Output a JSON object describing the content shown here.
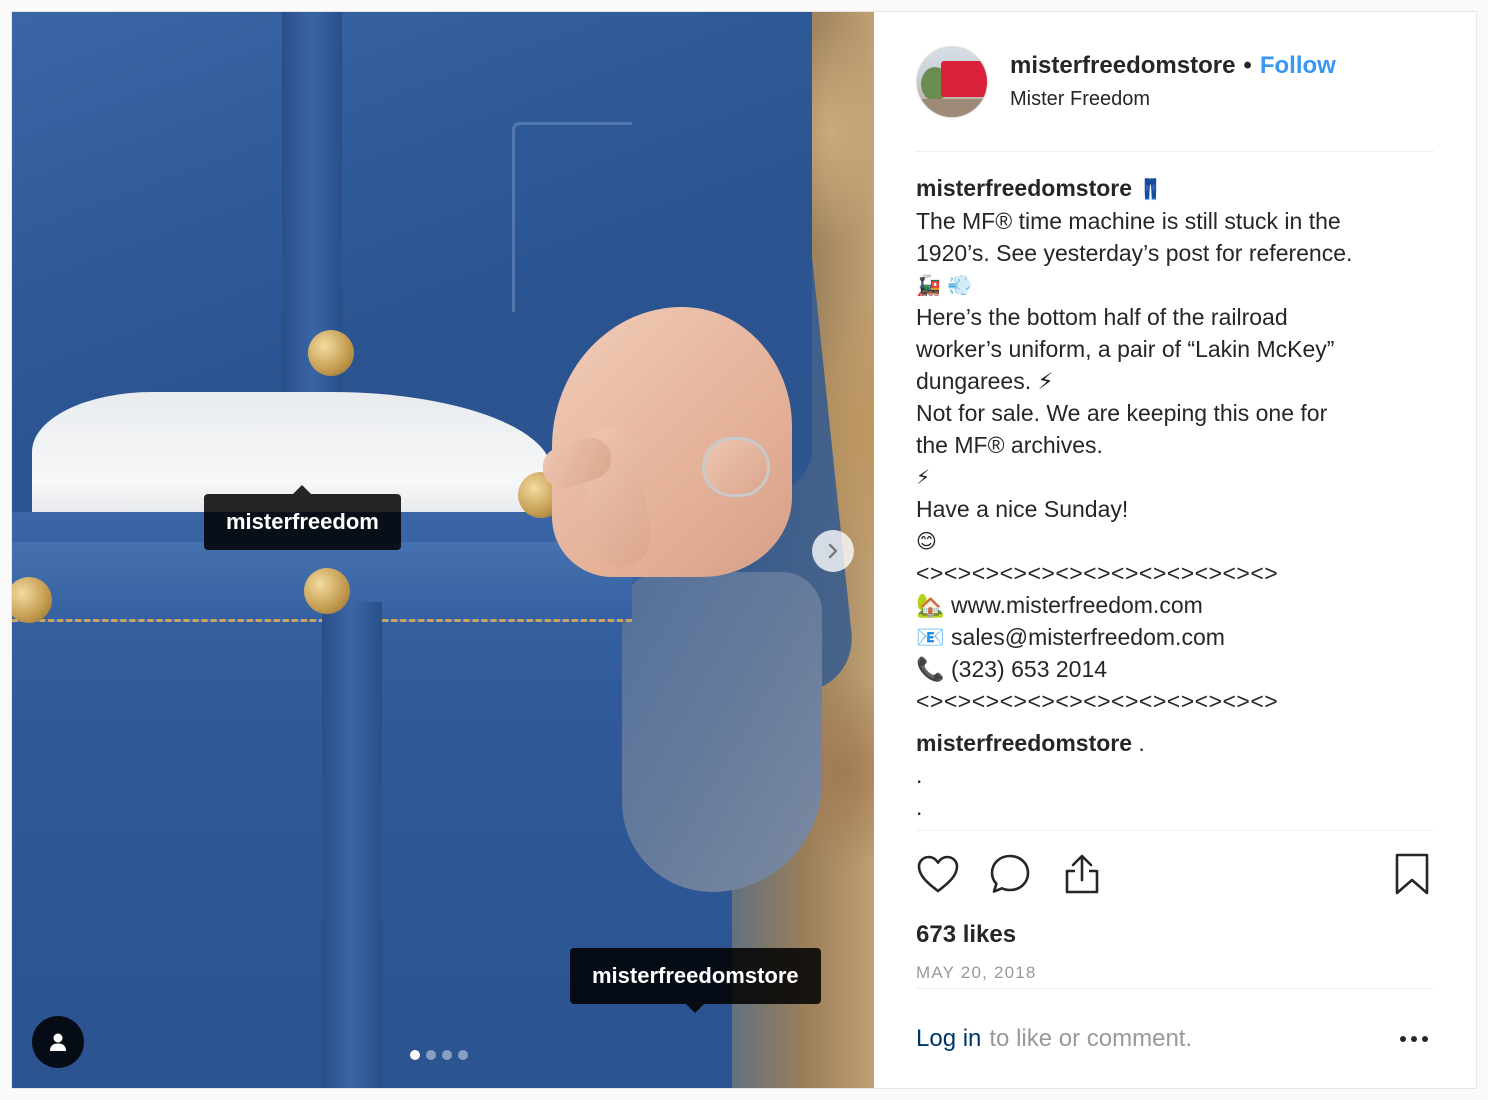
{
  "media": {
    "tags": [
      {
        "label": "misterfreedom"
      },
      {
        "label": "misterfreedomstore"
      }
    ],
    "next_icon": "chevron-right-icon",
    "user_tags_icon": "person-icon",
    "carousel": {
      "total": 4,
      "active": 1
    }
  },
  "header": {
    "username": "misterfreedomstore",
    "separator": "•",
    "follow_label": "Follow",
    "location": "Mister Freedom"
  },
  "caption": {
    "author": "misterfreedomstore",
    "author_emoji": "👖",
    "lines": [
      "The MF® time machine is still stuck in the",
      "1920’s. See yesterday’s post for reference.",
      "🚂 💨",
      "Here’s the bottom half of the railroad",
      "worker’s uniform, a pair of “Lakin McKey”",
      "dungarees. ⚡",
      "Not for sale. We are keeping this one for",
      "the MF® archives.",
      "⚡",
      "Have a nice Sunday!",
      "😊",
      "<><><><><><><><><><><><><>",
      "🏡 www.misterfreedom.com",
      "📧  sales@misterfreedom.com",
      "📞 (323) 653 2014",
      "<><><><><><><><><><><><><>"
    ]
  },
  "comment": {
    "author": "misterfreedomstore",
    "lines": [
      " .",
      ".",
      "."
    ]
  },
  "actions": {
    "icons": [
      "heart-icon",
      "comment-icon",
      "share-icon",
      "bookmark-icon"
    ]
  },
  "likes": "673 likes",
  "date": "MAY 20, 2018",
  "login": {
    "link_label": "Log in",
    "text": "to like or comment."
  }
}
